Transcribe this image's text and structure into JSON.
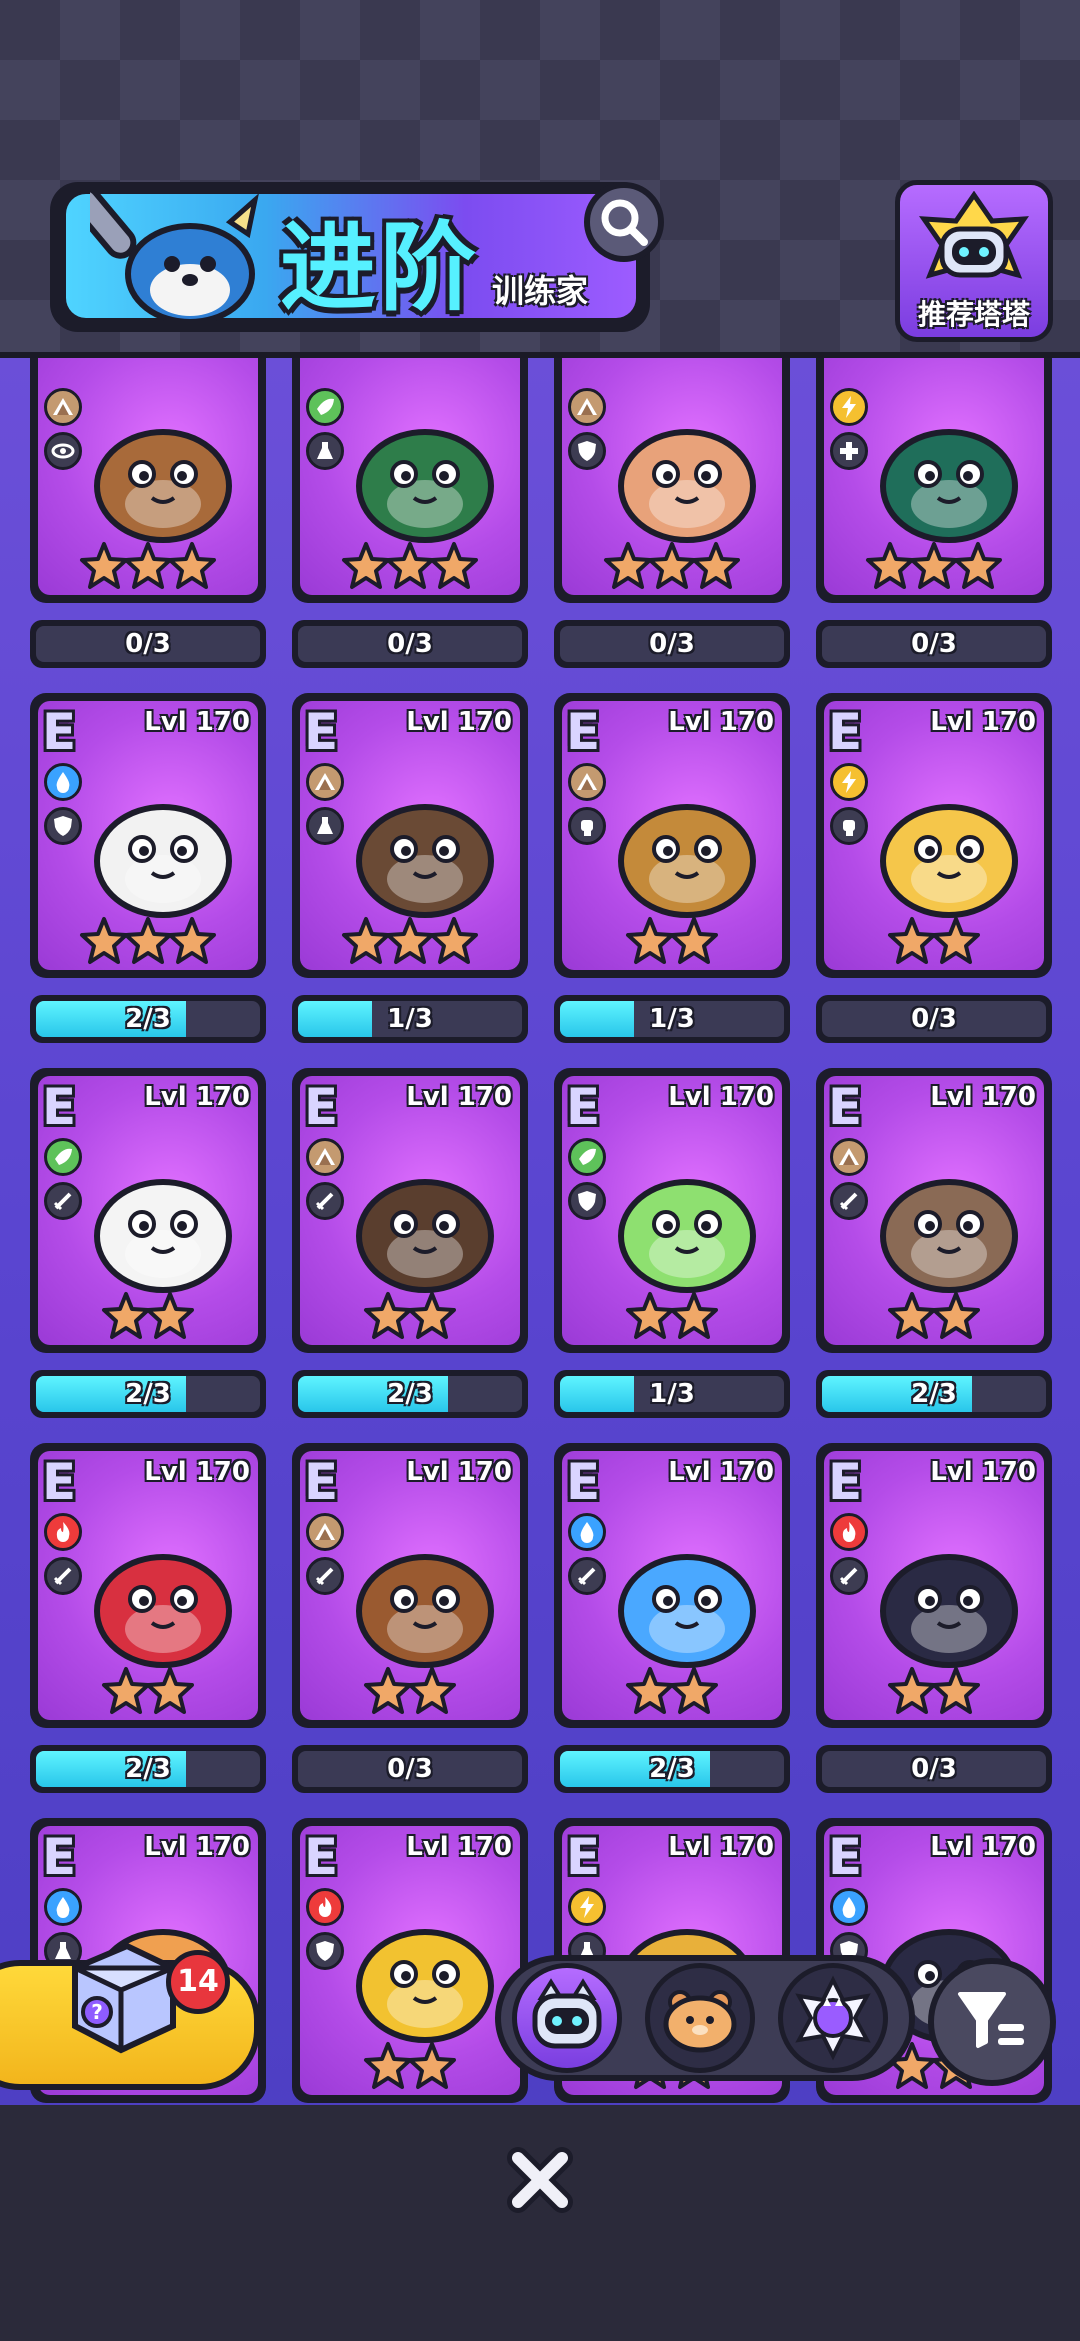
{
  "header": {
    "title": "进阶",
    "subtitle": "训练家",
    "recommend_label": "推荐塔塔"
  },
  "cards": [
    {
      "rank": "",
      "level": "",
      "element": "earth",
      "role": "eye",
      "stars": 3,
      "creature_color": "#a86a3a",
      "progress": "0/3",
      "fill": 0
    },
    {
      "rank": "",
      "level": "",
      "element": "leaf",
      "role": "flask",
      "stars": 3,
      "creature_color": "#2e7d4a",
      "progress": "0/3",
      "fill": 0
    },
    {
      "rank": "",
      "level": "",
      "element": "earth",
      "role": "shield",
      "stars": 3,
      "creature_color": "#e8a27a",
      "progress": "0/3",
      "fill": 0
    },
    {
      "rank": "",
      "level": "",
      "element": "bolt",
      "role": "cross",
      "stars": 3,
      "creature_color": "#1f6e5a",
      "progress": "0/3",
      "fill": 0
    },
    {
      "rank": "E",
      "level": "Lvl 170",
      "element": "water",
      "role": "shield",
      "stars": 3,
      "creature_color": "#f2f2f2",
      "progress": "2/3",
      "fill": 0.67
    },
    {
      "rank": "E",
      "level": "Lvl 170",
      "element": "earth",
      "role": "flask",
      "stars": 3,
      "creature_color": "#6a4a35",
      "progress": "1/3",
      "fill": 0.33
    },
    {
      "rank": "E",
      "level": "Lvl 170",
      "element": "earth",
      "role": "fist",
      "stars": 2,
      "creature_color": "#c48a3a",
      "progress": "1/3",
      "fill": 0.33
    },
    {
      "rank": "E",
      "level": "Lvl 170",
      "element": "bolt",
      "role": "fist",
      "stars": 2,
      "creature_color": "#f5c64a",
      "progress": "0/3",
      "fill": 0
    },
    {
      "rank": "E",
      "level": "Lvl 170",
      "element": "leaf",
      "role": "sword",
      "stars": 2,
      "creature_color": "#f4f4f4",
      "progress": "2/3",
      "fill": 0.67
    },
    {
      "rank": "E",
      "level": "Lvl 170",
      "element": "earth",
      "role": "sword",
      "stars": 2,
      "creature_color": "#5a3e2e",
      "progress": "2/3",
      "fill": 0.67
    },
    {
      "rank": "E",
      "level": "Lvl 170",
      "element": "leaf",
      "role": "shield",
      "stars": 2,
      "creature_color": "#8ee070",
      "progress": "1/3",
      "fill": 0.33
    },
    {
      "rank": "E",
      "level": "Lvl 170",
      "element": "earth",
      "role": "sword",
      "stars": 2,
      "creature_color": "#8a6a55",
      "progress": "2/3",
      "fill": 0.67
    },
    {
      "rank": "E",
      "level": "Lvl 170",
      "element": "fire",
      "role": "sword",
      "stars": 2,
      "creature_color": "#d83040",
      "progress": "2/3",
      "fill": 0.67
    },
    {
      "rank": "E",
      "level": "Lvl 170",
      "element": "earth",
      "role": "sword",
      "stars": 2,
      "creature_color": "#9a5a30",
      "progress": "0/3",
      "fill": 0
    },
    {
      "rank": "E",
      "level": "Lvl 170",
      "element": "water",
      "role": "sword",
      "stars": 2,
      "creature_color": "#4aa8ff",
      "progress": "2/3",
      "fill": 0.67
    },
    {
      "rank": "E",
      "level": "Lvl 170",
      "element": "fire",
      "role": "sword",
      "stars": 2,
      "creature_color": "#2a2a44",
      "progress": "0/3",
      "fill": 0
    },
    {
      "rank": "E",
      "level": "Lvl 170",
      "element": "water",
      "role": "flask",
      "stars": 2,
      "creature_color": "#f0a050",
      "progress": "",
      "fill": 0
    },
    {
      "rank": "E",
      "level": "Lvl 170",
      "element": "fire",
      "role": "shield",
      "stars": 2,
      "creature_color": "#f2c230",
      "progress": "",
      "fill": 0
    },
    {
      "rank": "E",
      "level": "Lvl 170",
      "element": "bolt",
      "role": "flask",
      "stars": 2,
      "creature_color": "#e8b03a",
      "progress": "",
      "fill": 0
    },
    {
      "rank": "E",
      "level": "Lvl 170",
      "element": "water",
      "role": "shield",
      "stars": 2,
      "creature_color": "#2a2a44",
      "progress": "",
      "fill": 0
    }
  ],
  "box": {
    "badge_count": "14"
  },
  "filter_tabs": [
    {
      "name": "tower-cat",
      "active": true
    },
    {
      "name": "creature-hamster",
      "active": false
    },
    {
      "name": "crystal-cat",
      "active": false
    }
  ],
  "colors": {
    "earth": "#c49a70",
    "leaf": "#5ec25a",
    "water": "#3aa2ff",
    "bolt": "#f5c030",
    "fire": "#ee3b3b",
    "star": "#f0a868",
    "progress_fill": "#3fd8f2"
  }
}
